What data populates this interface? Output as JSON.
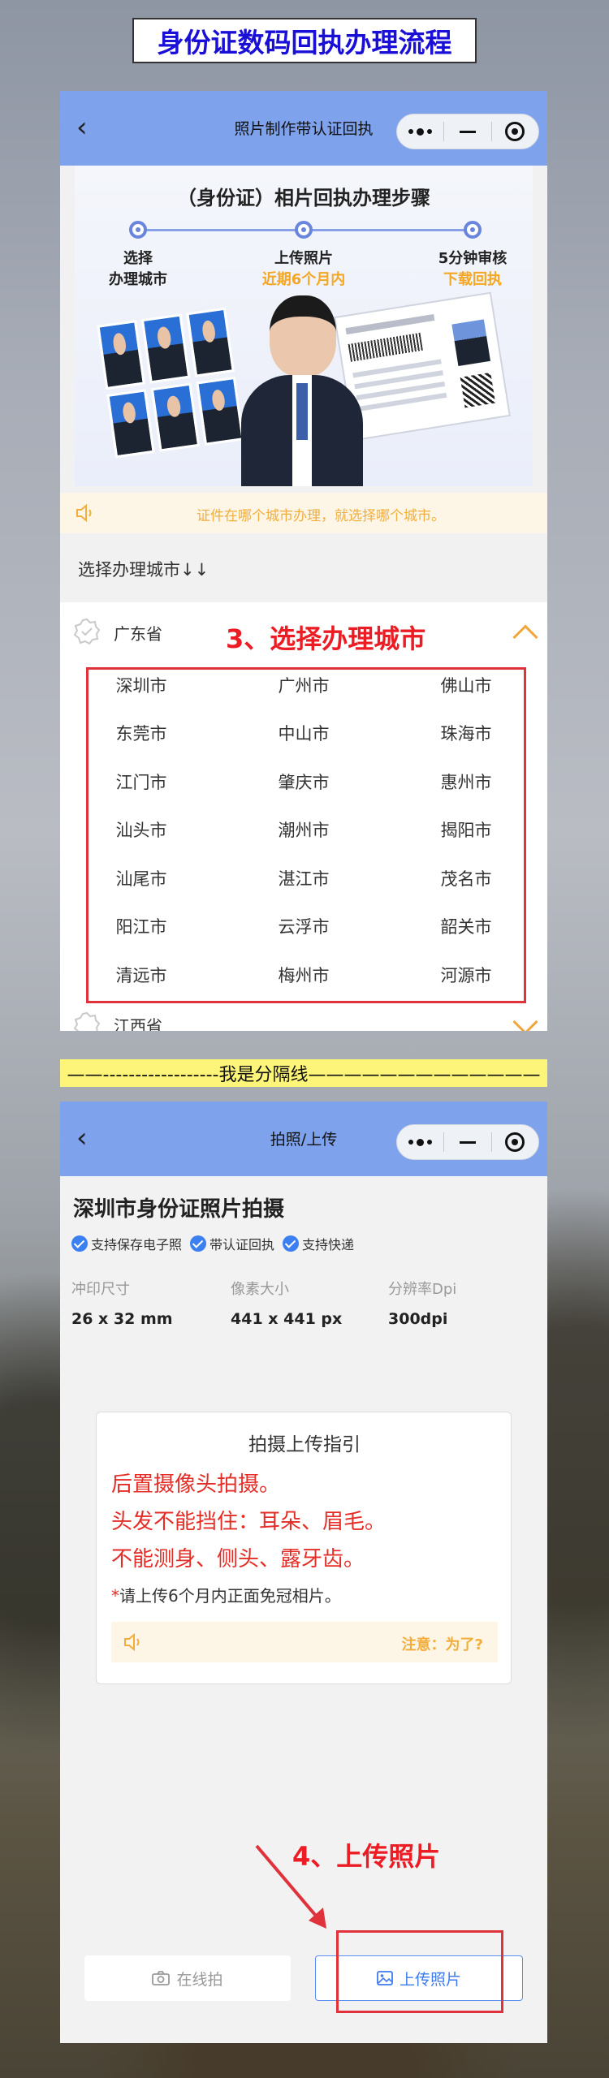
{
  "page_title": "身份证数码回执办理流程",
  "colors": {
    "navbar": "#7fa2ec",
    "accent_orange": "#f5a623",
    "annotation_red": "#ec1c24",
    "title_blue": "#1a0fd6",
    "divider_yellow": "#fcf579"
  },
  "screen1": {
    "nav_title": "照片制作带认证回执",
    "nav_back_icon": "chevron-left-icon",
    "banner": {
      "title": "（身份证）相片回执办理步骤",
      "steps": [
        {
          "line1": "选择",
          "line2": "办理城市"
        },
        {
          "line1": "上传照片",
          "line2": "近期6个月内"
        },
        {
          "line1": "5分钟审核",
          "line2": "下载回执"
        }
      ]
    },
    "notice": "证件在哪个城市办理，就选择哪个城市。",
    "section_label": "选择办理城市↓↓",
    "province_open": "广东省",
    "province_next": "江西省",
    "annotation": "3、选择办理城市",
    "cities": [
      "深圳市",
      "广州市",
      "佛山市",
      "东莞市",
      "中山市",
      "珠海市",
      "江门市",
      "肇庆市",
      "惠州市",
      "汕头市",
      "潮州市",
      "揭阳市",
      "汕尾市",
      "湛江市",
      "茂名市",
      "阳江市",
      "云浮市",
      "韶关市",
      "清远市",
      "梅州市",
      "河源市"
    ]
  },
  "divider_text": "——------------------我是分隔线—————————————",
  "screen2": {
    "nav_title": "拍照/上传",
    "title": "深圳市身份证照片拍摄",
    "chips": [
      "支持保存电子照",
      "带认证回执",
      "支持快递"
    ],
    "specs": [
      {
        "label": "冲印尺寸",
        "value": "26 x 32 mm"
      },
      {
        "label": "像素大小",
        "value": "441 x 441 px"
      },
      {
        "label": "分辨率Dpi",
        "value": "300dpi"
      }
    ],
    "guide": {
      "title": "拍摄上传指引",
      "lines": [
        "后置摄像头拍摄。",
        "头发不能挡住：耳朵、眉毛。",
        "不能测身、侧头、露牙齿。"
      ],
      "star": "*",
      "small": "请上传6个月内正面免冠相片。",
      "notice": "注意：为了?"
    },
    "annotation": "4、上传照片",
    "btn_online": "在线拍",
    "btn_upload": "上传照片"
  }
}
